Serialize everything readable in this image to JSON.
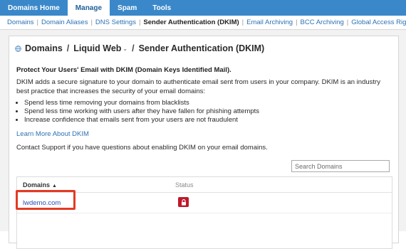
{
  "topnav": {
    "items": [
      {
        "label": "Domains Home"
      },
      {
        "label": "Manage"
      },
      {
        "label": "Spam"
      },
      {
        "label": "Tools"
      }
    ],
    "active_index": 1
  },
  "subnav": {
    "items": [
      {
        "label": "Domains"
      },
      {
        "label": "Domain Aliases"
      },
      {
        "label": "DNS Settings"
      },
      {
        "label": "Sender Authentication (DKIM)"
      },
      {
        "label": "Email Archiving"
      },
      {
        "label": "BCC Archiving"
      },
      {
        "label": "Global Access Rights"
      }
    ],
    "active_index": 3,
    "separator": "|"
  },
  "breadcrumb": {
    "icon": "globe-icon",
    "items": [
      "Domains",
      "Liquid Web",
      "Sender Authentication (DKIM)"
    ],
    "separator": "/",
    "dropdown_caret": "⌄"
  },
  "main": {
    "heading": "Protect Your Users' Email with DKIM (Domain Keys Identified Mail).",
    "description": "DKIM adds a secure signature to your domain to authenticate email sent from users in your company. DKIM is an industry best practice that increases the security of your email domains:",
    "bullets": [
      "Spend less time removing your domains from blacklists",
      "Spend less time working with users after they have fallen for phishing attempts",
      "Increase confidence that emails sent from your users are not fraudulent"
    ],
    "learn_more": "Learn More About DKIM",
    "contact": "Contact Support if you have questions about enabling DKIM on your email domains."
  },
  "search": {
    "placeholder": "Search Domains",
    "value": ""
  },
  "table": {
    "columns": [
      "Domains",
      "Status"
    ],
    "sort_arrow": "▲",
    "rows": [
      {
        "domain": "lwdemo.com",
        "status_icon": "lock-icon"
      }
    ]
  },
  "colors": {
    "nav_bg": "#3a88c9",
    "link": "#2c72b5",
    "status_red": "#c0182b",
    "highlight": "#e33a23"
  }
}
